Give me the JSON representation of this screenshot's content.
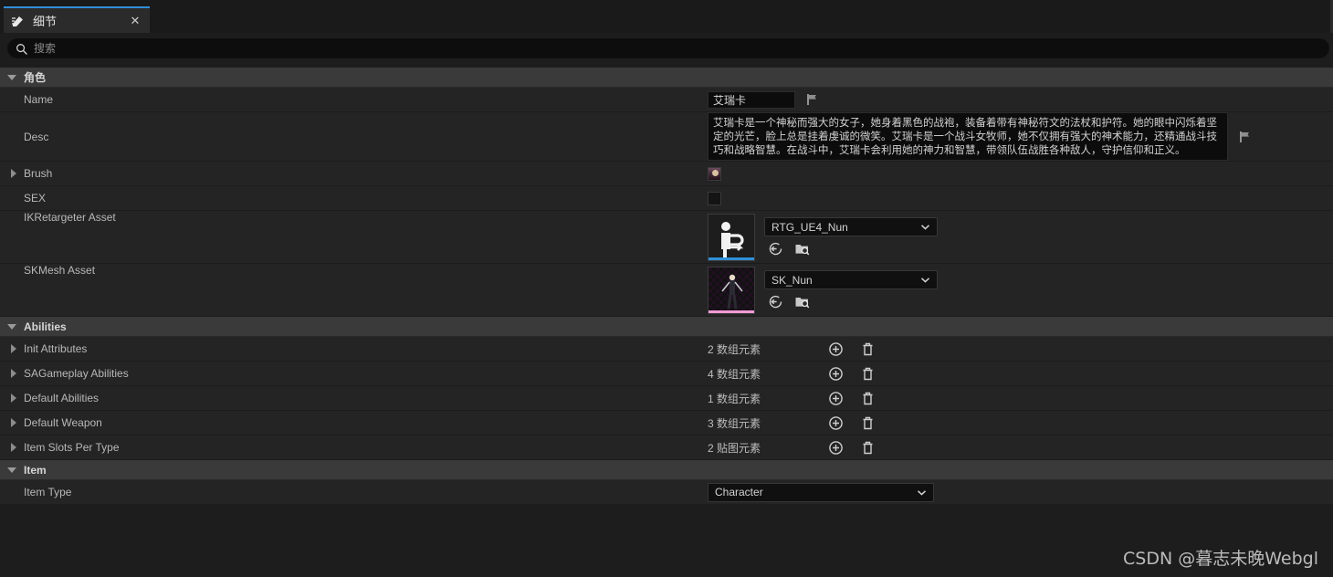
{
  "tab": {
    "icon": "details-pen-icon",
    "label": "细节",
    "close_label": "✕"
  },
  "search": {
    "icon": "search-icon",
    "placeholder": "搜索",
    "value": ""
  },
  "sections": [
    {
      "title": "角色",
      "expanded": true,
      "rows": [
        {
          "label": "Name",
          "kind": "text",
          "value": "艾瑞卡",
          "flag_icon": "flag-icon"
        },
        {
          "label": "Desc",
          "kind": "textarea",
          "value": "艾瑞卡是一个神秘而强大的女子，她身着黑色的战袍，装备着带有神秘符文的法杖和护符。她的眼中闪烁着坚定的光芒，脸上总是挂着虔诚的微笑。艾瑞卡是一个战斗女牧师，她不仅拥有强大的神术能力，还精通战斗技巧和战略智慧。在战斗中，艾瑞卡会利用她的神力和智慧，带领队伍战胜各种敌人，守护信仰和正义。",
          "flag_icon": "flag-icon"
        },
        {
          "label": "Brush",
          "kind": "thumb",
          "expandable": true
        },
        {
          "label": "SEX",
          "kind": "swatch"
        },
        {
          "label": "IKRetargeter Asset",
          "kind": "asset",
          "value": "RTG_UE4_Nun",
          "accent": "#2f8fd8",
          "thumb": "ik-retargeter-thumbnail",
          "use_selected_icon": "use-selected-asset-icon",
          "browse_icon": "browse-to-asset-icon"
        },
        {
          "label": "SKMesh Asset",
          "kind": "asset",
          "value": "SK_Nun",
          "accent": "#f09ad6",
          "thumb": "skeletal-mesh-thumbnail",
          "use_selected_icon": "use-selected-asset-icon",
          "browse_icon": "browse-to-asset-icon"
        }
      ]
    },
    {
      "title": "Abilities",
      "expanded": true,
      "rows": [
        {
          "label": "Init Attributes",
          "kind": "array",
          "count_text": "2 数组元素",
          "expandable": true
        },
        {
          "label": "SAGameplay Abilities",
          "kind": "array",
          "count_text": "4 数组元素",
          "expandable": true
        },
        {
          "label": "Default Abilities",
          "kind": "array",
          "count_text": "1 数组元素",
          "expandable": true
        },
        {
          "label": "Default Weapon",
          "kind": "array",
          "count_text": "3 数组元素",
          "expandable": true
        },
        {
          "label": "Item Slots Per Type",
          "kind": "array",
          "count_text": "2 贴图元素",
          "expandable": true
        }
      ]
    },
    {
      "title": "Item",
      "expanded": true,
      "rows": [
        {
          "label": "Item Type",
          "kind": "combo",
          "value": "Character"
        }
      ]
    }
  ],
  "array_buttons": {
    "add_icon": "add-element-icon",
    "delete_icon": "delete-elements-icon"
  },
  "watermark": "CSDN @暮志未晚Webgl",
  "colors": {
    "accent_blue": "#2f8fd8",
    "accent_pink": "#f09ad6",
    "panel_bg": "#242424",
    "section_bg": "#3a3a3a"
  }
}
